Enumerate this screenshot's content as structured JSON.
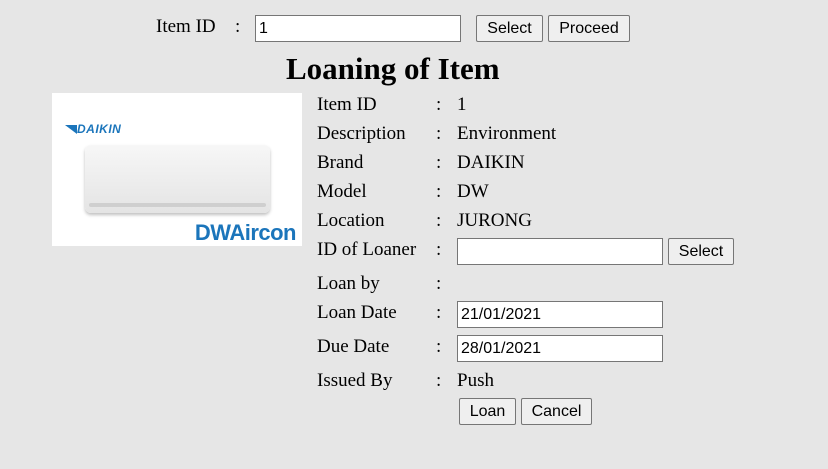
{
  "top_bar": {
    "item_id_label": "Item ID",
    "colon": ":",
    "item_id_value": "1",
    "select_label": "Select",
    "proceed_label": "Proceed"
  },
  "title": "Loaning of Item",
  "product_image": {
    "brand_logo_text": "DAIKIN",
    "watermark_text": "DWAircon"
  },
  "details": {
    "item_id": {
      "label": "Item ID",
      "value": "1"
    },
    "description": {
      "label": "Description",
      "value": "Environment"
    },
    "brand": {
      "label": "Brand",
      "value": "DAIKIN"
    },
    "model": {
      "label": "Model",
      "value": "DW"
    },
    "location": {
      "label": "Location",
      "value": "JURONG"
    },
    "loaner_id": {
      "label": "ID of Loaner",
      "value": "",
      "select_label": "Select"
    },
    "loan_by": {
      "label": "Loan by",
      "value": ""
    },
    "loan_date": {
      "label": "Loan Date",
      "value": "21/01/2021"
    },
    "due_date": {
      "label": "Due Date",
      "value": "28/01/2021"
    },
    "issued_by": {
      "label": "Issued By",
      "value": "Push"
    }
  },
  "actions": {
    "loan_label": "Loan",
    "cancel_label": "Cancel"
  },
  "colon": ":"
}
